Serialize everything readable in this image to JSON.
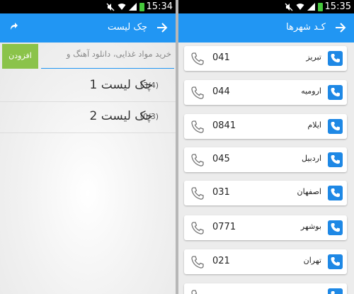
{
  "left_screen": {
    "status": {
      "time": "15:34"
    },
    "appbar": {
      "title": "چک لیست",
      "back_icon": "arrow-right-icon",
      "share_icon": "share-icon"
    },
    "add_button": {
      "label": "افزودن"
    },
    "input": {
      "value": "خرید مواد غذایی، دانلود آهنگ و"
    },
    "lists": [
      {
        "name": "چک لیست 1",
        "count": "(3/4)"
      },
      {
        "name": "چک لیست 2",
        "count": "(0/3)"
      }
    ]
  },
  "right_screen": {
    "status": {
      "time": "15:35"
    },
    "appbar": {
      "title": "کـد شهرها",
      "back_icon": "arrow-right-icon"
    },
    "cities": [
      {
        "city": "تبریز",
        "code": "041"
      },
      {
        "city": "ارومیه",
        "code": "044"
      },
      {
        "city": "ایلام",
        "code": "0841"
      },
      {
        "city": "اردبیل",
        "code": "045"
      },
      {
        "city": "اصفهان",
        "code": "031"
      },
      {
        "city": "بوشهر",
        "code": "0771"
      },
      {
        "city": "تهران",
        "code": "021"
      },
      {
        "city": "",
        "code": ""
      }
    ]
  },
  "colors": {
    "appbar": "#2196f3",
    "add_button": "#8bc34a",
    "badge": "#1e88e5"
  }
}
